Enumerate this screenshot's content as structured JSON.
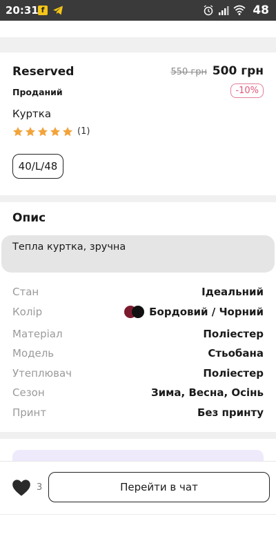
{
  "status_bar": {
    "time": "20:31",
    "battery": "48",
    "icons": [
      "notification-f-icon",
      "telegram-icon",
      "alarm-icon",
      "signal-icon",
      "wifi-icon"
    ]
  },
  "product": {
    "brand": "Reserved",
    "old_price": "550 грн",
    "price": "500 грн",
    "status": "Проданий",
    "discount": "-10%",
    "title": "Куртка",
    "rating": 5,
    "reviews": "(1)",
    "size": "40/L/48"
  },
  "description": {
    "title": "Опис",
    "text": "Тепла куртка, зручна"
  },
  "properties": [
    {
      "key": "Стан",
      "value": "Ідеальний"
    },
    {
      "key": "Колір",
      "value": "Бордовий / Чорний",
      "colors": [
        "#7a1b2d",
        "#111111"
      ]
    },
    {
      "key": "Матеріал",
      "value": "Поліестер"
    },
    {
      "key": "Модель",
      "value": "Стьобана"
    },
    {
      "key": "Утеплювач",
      "value": "Поліестер"
    },
    {
      "key": "Сезон",
      "value": "Зима, Весна, Осінь"
    },
    {
      "key": "Принт",
      "value": "Без принту"
    }
  ],
  "bottom_bar": {
    "likes": "3",
    "chat_button": "Перейти в чат"
  },
  "colors": {
    "accent_pink": "#e0567a",
    "star": "#f2a33a",
    "separator": "#f0f0f0"
  }
}
